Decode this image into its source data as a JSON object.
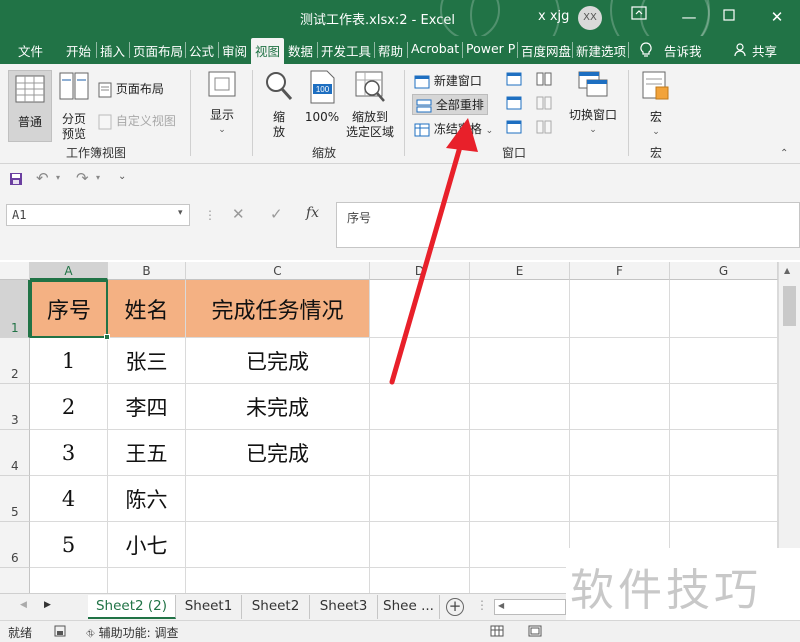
{
  "window": {
    "title": "测试工作表.xlsx:2  -  Excel",
    "user": "x xjg",
    "avatar": "XX",
    "minimize": "—",
    "restore": "❐",
    "close": "✕"
  },
  "tabs": [
    {
      "label": "文件"
    },
    {
      "label": "开始"
    },
    {
      "label": "插入"
    },
    {
      "label": "页面布局"
    },
    {
      "label": "公式"
    },
    {
      "label": "审阅"
    },
    {
      "label": "视图",
      "active": true
    },
    {
      "label": "数据"
    },
    {
      "label": "开发工具"
    },
    {
      "label": "帮助"
    },
    {
      "label": "Acrobat"
    },
    {
      "label": "Power P"
    },
    {
      "label": "百度网盘"
    },
    {
      "label": "新建选项"
    }
  ],
  "tell_me": "告诉我",
  "share": "共享",
  "ribbon": {
    "workbook_views": {
      "group_label": "工作簿视图",
      "normal": "普通",
      "page_break_line1": "分页",
      "page_break_line2": "预览",
      "page_layout": "页面布局",
      "custom_views": "自定义视图"
    },
    "show": {
      "label": "显示"
    },
    "zoom": {
      "group_label": "缩放",
      "zoom_line1": "缩",
      "zoom_line2": "放",
      "hundred": "100%",
      "zoom_selection_line1": "缩放到",
      "zoom_selection_line2": "选定区域",
      "icon_text": "100"
    },
    "window": {
      "group_label": "窗口",
      "new_window": "新建窗口",
      "arrange_all": "全部重排",
      "freeze_panes": "冻结窗格",
      "switch_windows": "切换窗口"
    },
    "macros": {
      "group_label": "宏",
      "label": "宏"
    }
  },
  "name_box": "A1",
  "fx_label": "fx",
  "formula_value": "序号",
  "columns": [
    "A",
    "B",
    "C",
    "D",
    "E",
    "F",
    "G"
  ],
  "rows": [
    "1",
    "2",
    "3",
    "4",
    "5",
    "6"
  ],
  "table": {
    "headers": [
      "序号",
      "姓名",
      "完成任务情况"
    ],
    "data": [
      [
        "1",
        "张三",
        "已完成"
      ],
      [
        "2",
        "李四",
        "未完成"
      ],
      [
        "3",
        "王五",
        "已完成"
      ],
      [
        "4",
        "陈六",
        ""
      ],
      [
        "5",
        "小七",
        ""
      ]
    ],
    "header_color": "#f4b183"
  },
  "sheets": {
    "active": "Sheet2 (2)",
    "others": [
      "Sheet1",
      "Sheet2",
      "Sheet3",
      "Shee ..."
    ],
    "add": "+"
  },
  "status": {
    "ready": "就绪",
    "accessibility": "辅助功能: 调查"
  },
  "watermark": "软件技巧",
  "colors": {
    "accent": "#217346",
    "arrow": "#e8202a"
  }
}
